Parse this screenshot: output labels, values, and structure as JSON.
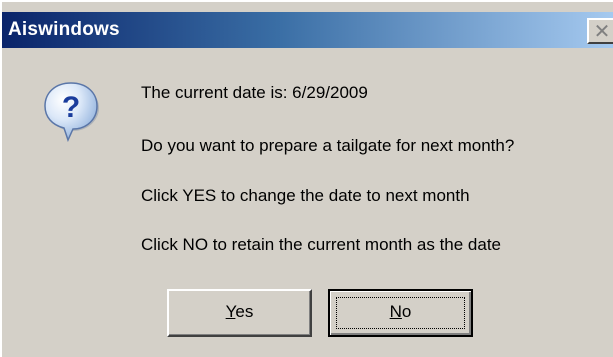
{
  "window": {
    "title": "Aiswindows",
    "close_glyph": "✕"
  },
  "icon": {
    "name": "question-icon",
    "glyph": "?"
  },
  "messages": [
    "The current date is: 6/29/2009",
    "Do you want to prepare a tailgate for next month?",
    "Click YES to change the date to next month",
    "Click NO to retain the current month as the date"
  ],
  "buttons": {
    "yes": {
      "mnemonic": "Y",
      "rest": "es"
    },
    "no": {
      "mnemonic": "N",
      "rest": "o"
    }
  }
}
